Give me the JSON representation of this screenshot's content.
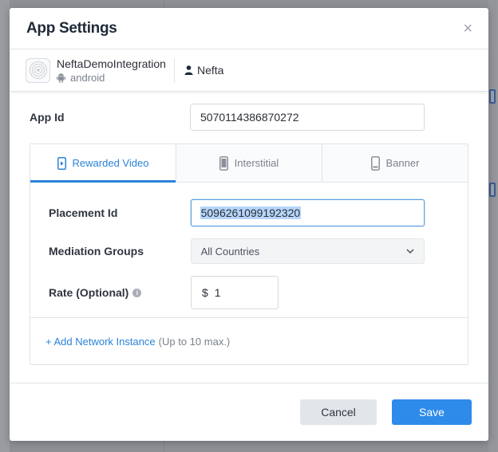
{
  "modal": {
    "title": "App Settings",
    "close_glyph": "×"
  },
  "app": {
    "name": "NeftaDemoIntegration",
    "platform": "android",
    "account": "Nefta"
  },
  "fields": {
    "app_id_label": "App Id",
    "app_id_value": "5070114386870272"
  },
  "tabs": [
    {
      "label": "Rewarded Video",
      "icon": "play-rect-icon",
      "active": true
    },
    {
      "label": "Interstitial",
      "icon": "phone-icon",
      "active": false
    },
    {
      "label": "Banner",
      "icon": "mobile-icon",
      "active": false
    }
  ],
  "placement": {
    "placement_label": "Placement Id",
    "placement_value": "5096261099192320",
    "mediation_label": "Mediation Groups",
    "mediation_value": "All Countries",
    "rate_label": "Rate (Optional)",
    "rate_currency": "$",
    "rate_value": "1",
    "info_glyph": "i"
  },
  "network": {
    "add_label": "+ Add Network Instance",
    "add_hint": "(Up to 10 max.)"
  },
  "footer": {
    "cancel_label": "Cancel",
    "save_label": "Save"
  },
  "colors": {
    "accent": "#2b83d8",
    "save_bg": "#2e8bea",
    "cancel_bg": "#e2e5e9"
  }
}
